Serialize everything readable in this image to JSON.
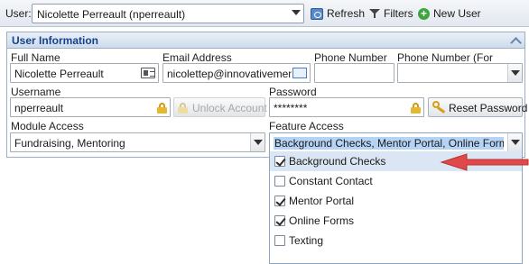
{
  "toolbar": {
    "user_label": "User:",
    "user_value": "Nicolette Perreault (nperreault)",
    "refresh_label": "Refresh",
    "filters_label": "Filters",
    "new_user_label": "New User"
  },
  "panel": {
    "title": "User Information",
    "full_name_label": "Full Name",
    "full_name_value": "Nicolette Perreault",
    "email_label": "Email Address",
    "email_value": "nicolettep@innovativementor",
    "phone_label": "Phone Number",
    "phone_value": "",
    "phone_texting_label": "Phone Number (For Texting)",
    "phone_texting_value": "",
    "username_label": "Username",
    "username_value": "nperreault",
    "unlock_label": "Unlock Account",
    "password_label": "Password",
    "password_value": "********",
    "reset_label": "Reset Password",
    "module_label": "Module Access",
    "module_value": "Fundraising, Mentoring",
    "feature_label": "Feature Access",
    "feature_value": "Background Checks, Mentor Portal, Online Forms"
  },
  "feature_options": [
    {
      "label": "Background Checks",
      "checked": true
    },
    {
      "label": "Constant Contact",
      "checked": false
    },
    {
      "label": "Mentor Portal",
      "checked": true
    },
    {
      "label": "Online Forms",
      "checked": true
    },
    {
      "label": "Texting",
      "checked": false
    }
  ],
  "colors": {
    "annotation_arrow": "#e0484a",
    "highlight": "#dbe6f4",
    "header_text": "#15428b"
  }
}
